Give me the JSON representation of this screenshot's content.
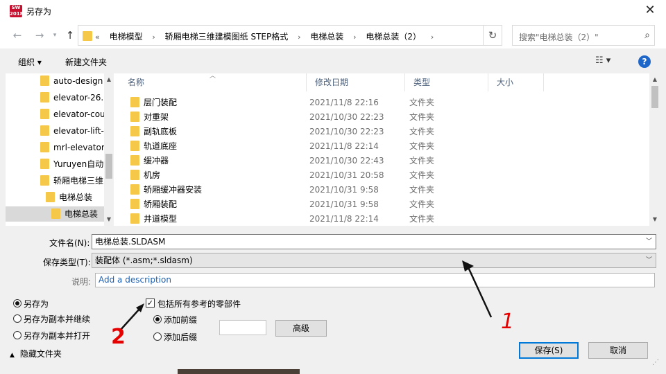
{
  "window": {
    "app_icon_text": "SW 2018",
    "title": "另存为"
  },
  "nav": {
    "breadcrumbs": [
      "电梯模型",
      "轿厢电梯三维建模图纸 STEP格式",
      "电梯总装",
      "电梯总装（2）"
    ],
    "search_placeholder": "搜索\"电梯总装（2）\""
  },
  "toolbar": {
    "organize": "组织 ▾",
    "new_folder": "新建文件夹"
  },
  "tree": {
    "items": [
      {
        "label": "auto-design"
      },
      {
        "label": "elevator-26."
      },
      {
        "label": "elevator-cou"
      },
      {
        "label": "elevator-lift-"
      },
      {
        "label": "mrl-elevator"
      },
      {
        "label": "Yuruyen自动"
      },
      {
        "label": "轿厢电梯三维"
      },
      {
        "label": "电梯总装"
      },
      {
        "label": "电梯总装"
      }
    ]
  },
  "columns": {
    "name": "名称",
    "date": "修改日期",
    "type": "类型",
    "size": "大小"
  },
  "files": [
    {
      "name": "层门装配",
      "date": "2021/11/8 22:16",
      "type": "文件夹"
    },
    {
      "name": "对重架",
      "date": "2021/10/30 22:23",
      "type": "文件夹"
    },
    {
      "name": "副轨底板",
      "date": "2021/10/30 22:23",
      "type": "文件夹"
    },
    {
      "name": "轨道底座",
      "date": "2021/11/8 22:14",
      "type": "文件夹"
    },
    {
      "name": "缓冲器",
      "date": "2021/10/30 22:43",
      "type": "文件夹"
    },
    {
      "name": "机房",
      "date": "2021/10/31 20:58",
      "type": "文件夹"
    },
    {
      "name": "轿厢缓冲器安装",
      "date": "2021/10/31 9:58",
      "type": "文件夹"
    },
    {
      "name": "轿厢装配",
      "date": "2021/10/31 9:58",
      "type": "文件夹"
    },
    {
      "name": "井道模型",
      "date": "2021/11/8 22:14",
      "type": "文件夹"
    }
  ],
  "form": {
    "filename_label": "文件名(N):",
    "filename_value": "电梯总装.SLDASM",
    "filetype_label": "保存类型(T):",
    "filetype_value": "装配体 (*.asm;*.sldasm)",
    "desc_label": "说明:",
    "desc_value": "Add a description"
  },
  "options": {
    "save_as": "另存为",
    "save_copy_continue": "另存为副本并继续",
    "save_copy_open": "另存为副本并打开",
    "include_refs": "包括所有参考的零部件",
    "add_prefix": "添加前缀",
    "add_suffix": "添加后缀",
    "advanced": "高级"
  },
  "footer": {
    "hide_folders": "隐藏文件夹",
    "save_button": "保存(S)",
    "cancel_button": "取消"
  },
  "annotations": {
    "mark_1": "1",
    "mark_2": "2"
  }
}
